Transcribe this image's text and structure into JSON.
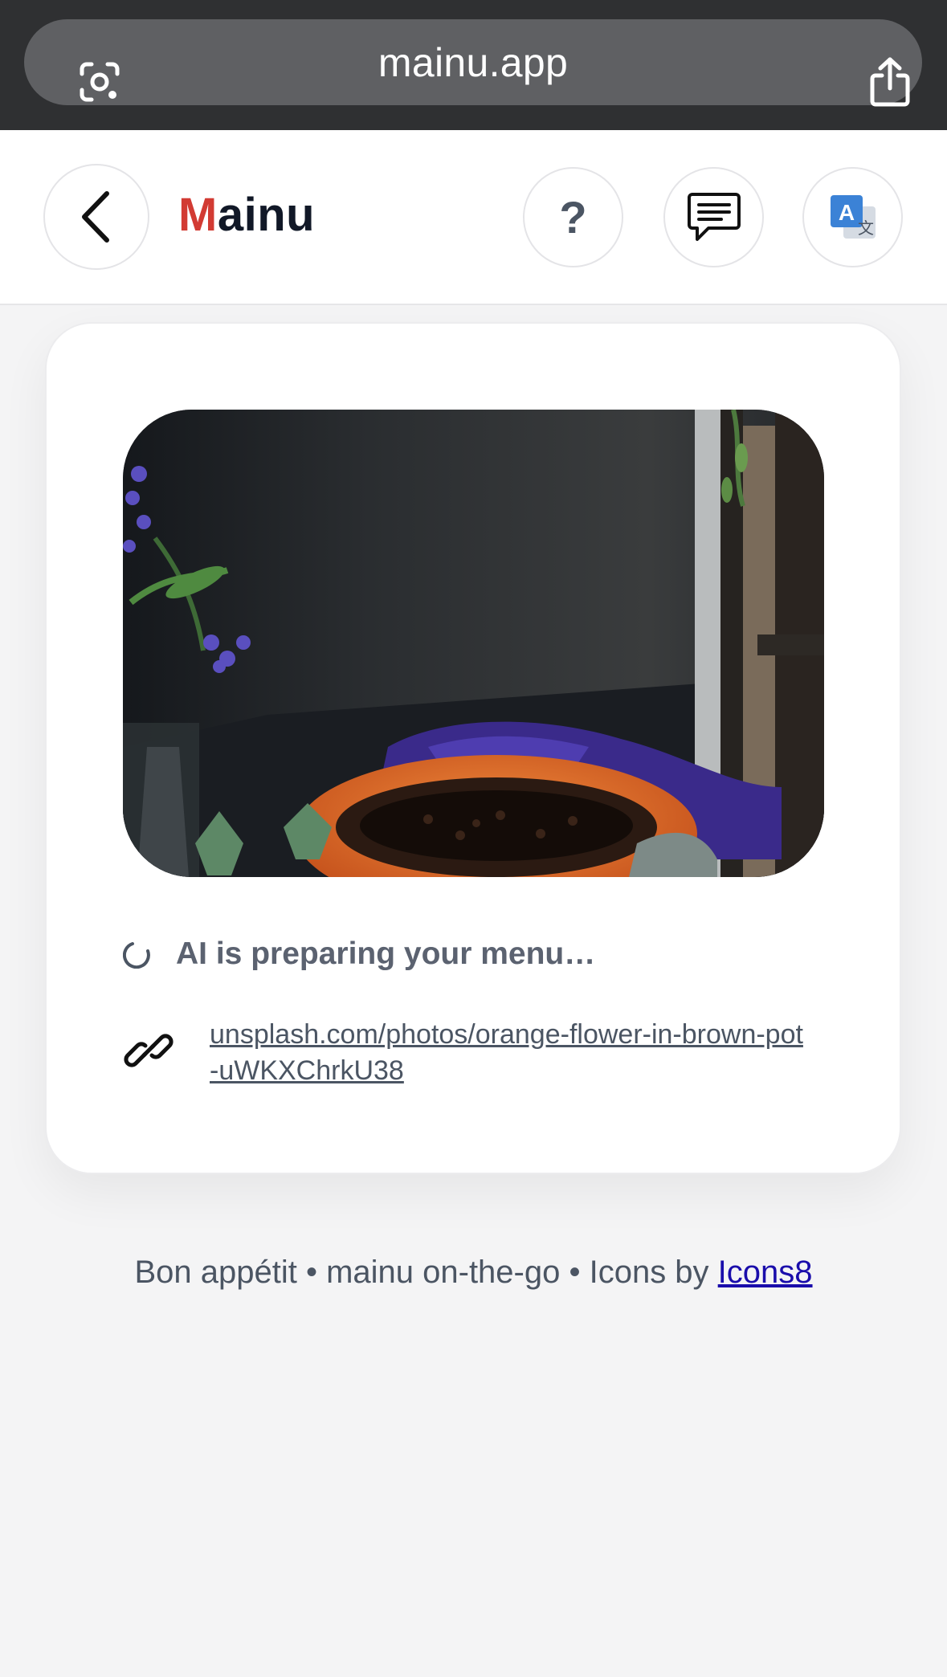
{
  "browser": {
    "url": "mainu.app",
    "left_icon": "lens-icon",
    "right_icon": "share-icon"
  },
  "header": {
    "brand_first_letter": "M",
    "brand_rest": "ainu",
    "brand_accent_color": "#d23b33",
    "back_icon": "chevron-left-icon",
    "help_label": "?",
    "chat_icon": "chat-bubble-icon",
    "translate_icon": "translate-icon"
  },
  "card": {
    "image_description_icon": "papaya-photo",
    "status_text": "AI is preparing your menu…",
    "status_icon": "spinner-icon",
    "link_icon": "link-icon",
    "source_link": "unsplash.com/photos/orange-flower-in-brown-pot-uWKXChrkU38"
  },
  "footer": {
    "text": "Bon appétit • mainu on-the-go • Icons by ",
    "link_label": "Icons8"
  }
}
